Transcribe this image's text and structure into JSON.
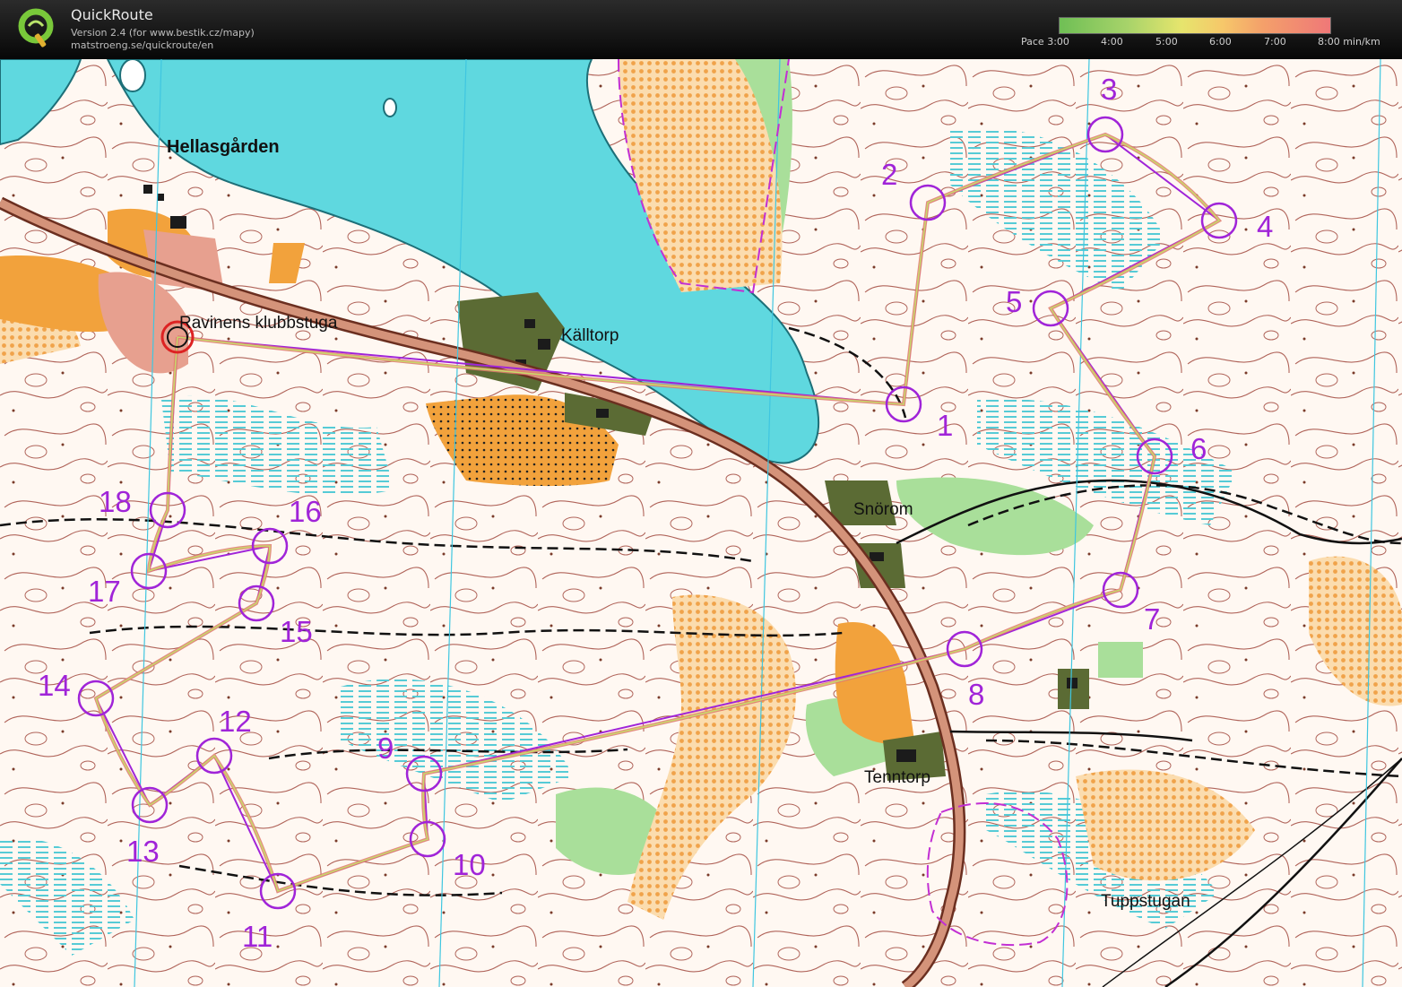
{
  "header": {
    "title": "QuickRoute",
    "version": "Version 2.4  (for www.bestik.cz/mapy)",
    "url": "matstroeng.se/quickroute/en",
    "pace_labels": [
      "Pace 3:00",
      "4:00",
      "5:00",
      "6:00",
      "7:00",
      "8:00  min/km"
    ],
    "pace_colors": [
      "#6fbf55",
      "#a7d36a",
      "#e6e56d",
      "#f6c86a",
      "#f4a06a",
      "#ef7878"
    ]
  },
  "map": {
    "place_names": {
      "hellasgarden": "Hellasgården",
      "ravinens": "Ravinens klubbstuga",
      "kalltorp": "Källtorp",
      "snorom": "Snörom",
      "tenntorp": "Tenntorp",
      "tuppstugan": "Tuppstugan"
    },
    "course": {
      "color": "#a024d8",
      "controls": [
        {
          "num": "1"
        },
        {
          "num": "2"
        },
        {
          "num": "3"
        },
        {
          "num": "4"
        },
        {
          "num": "5"
        },
        {
          "num": "6"
        },
        {
          "num": "7"
        },
        {
          "num": "8"
        },
        {
          "num": "9"
        },
        {
          "num": "10"
        },
        {
          "num": "11"
        },
        {
          "num": "12"
        },
        {
          "num": "13"
        },
        {
          "num": "14"
        },
        {
          "num": "15"
        },
        {
          "num": "16"
        },
        {
          "num": "17"
        },
        {
          "num": "18"
        }
      ]
    },
    "colors": {
      "water": "#5fd8df",
      "contour": "#b0645a",
      "road": "#d4937a",
      "open_land": "#f2a23c",
      "green": "#a9df9a",
      "marsh": "#7fd7e0",
      "building": "#4a5a2a"
    }
  }
}
